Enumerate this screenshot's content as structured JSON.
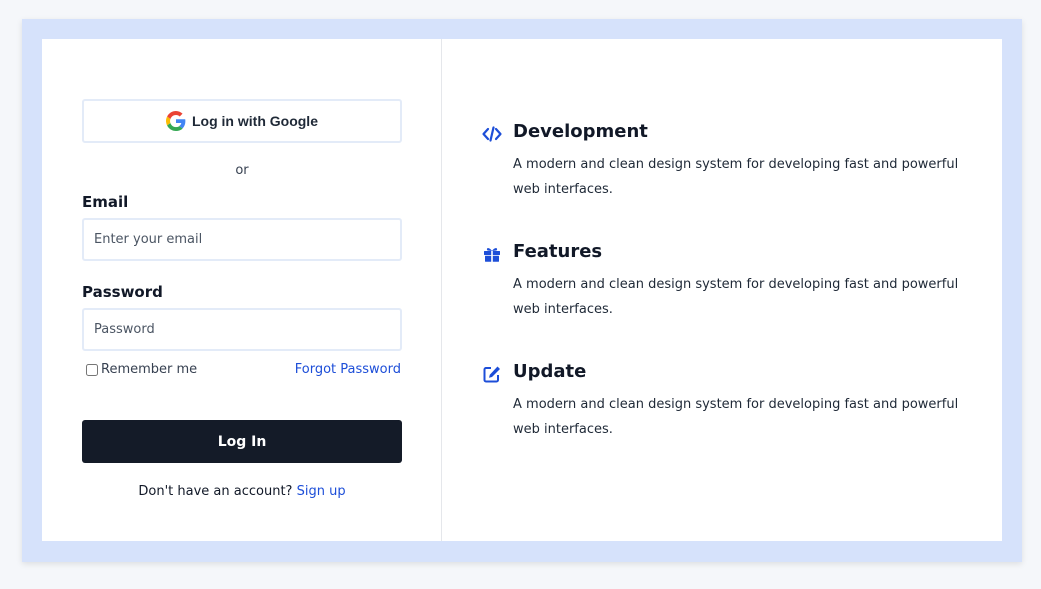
{
  "login": {
    "google_label": "Log in with Google",
    "or_text": "or",
    "email_label": "Email",
    "email_placeholder": "Enter your email",
    "email_value": "",
    "password_label": "Password",
    "password_placeholder": "Password",
    "password_value": "",
    "remember_label": "Remember me",
    "remember_checked": false,
    "forgot_label": "Forgot Password",
    "submit_label": "Log In",
    "signup_prompt": "Don't have an account?",
    "signup_link": "Sign up"
  },
  "features": [
    {
      "icon": "code-icon",
      "title": "Development",
      "description": "A modern and clean design system for developing fast and powerful web interfaces."
    },
    {
      "icon": "gift-icon",
      "title": "Features",
      "description": "A modern and clean design system for developing fast and powerful web interfaces."
    },
    {
      "icon": "edit-icon",
      "title": "Update",
      "description": "A modern and clean design system for developing fast and powerful web interfaces."
    }
  ],
  "colors": {
    "accent": "#1d4ed8",
    "button_dark": "#141b28",
    "frame": "#d6e2fb"
  }
}
